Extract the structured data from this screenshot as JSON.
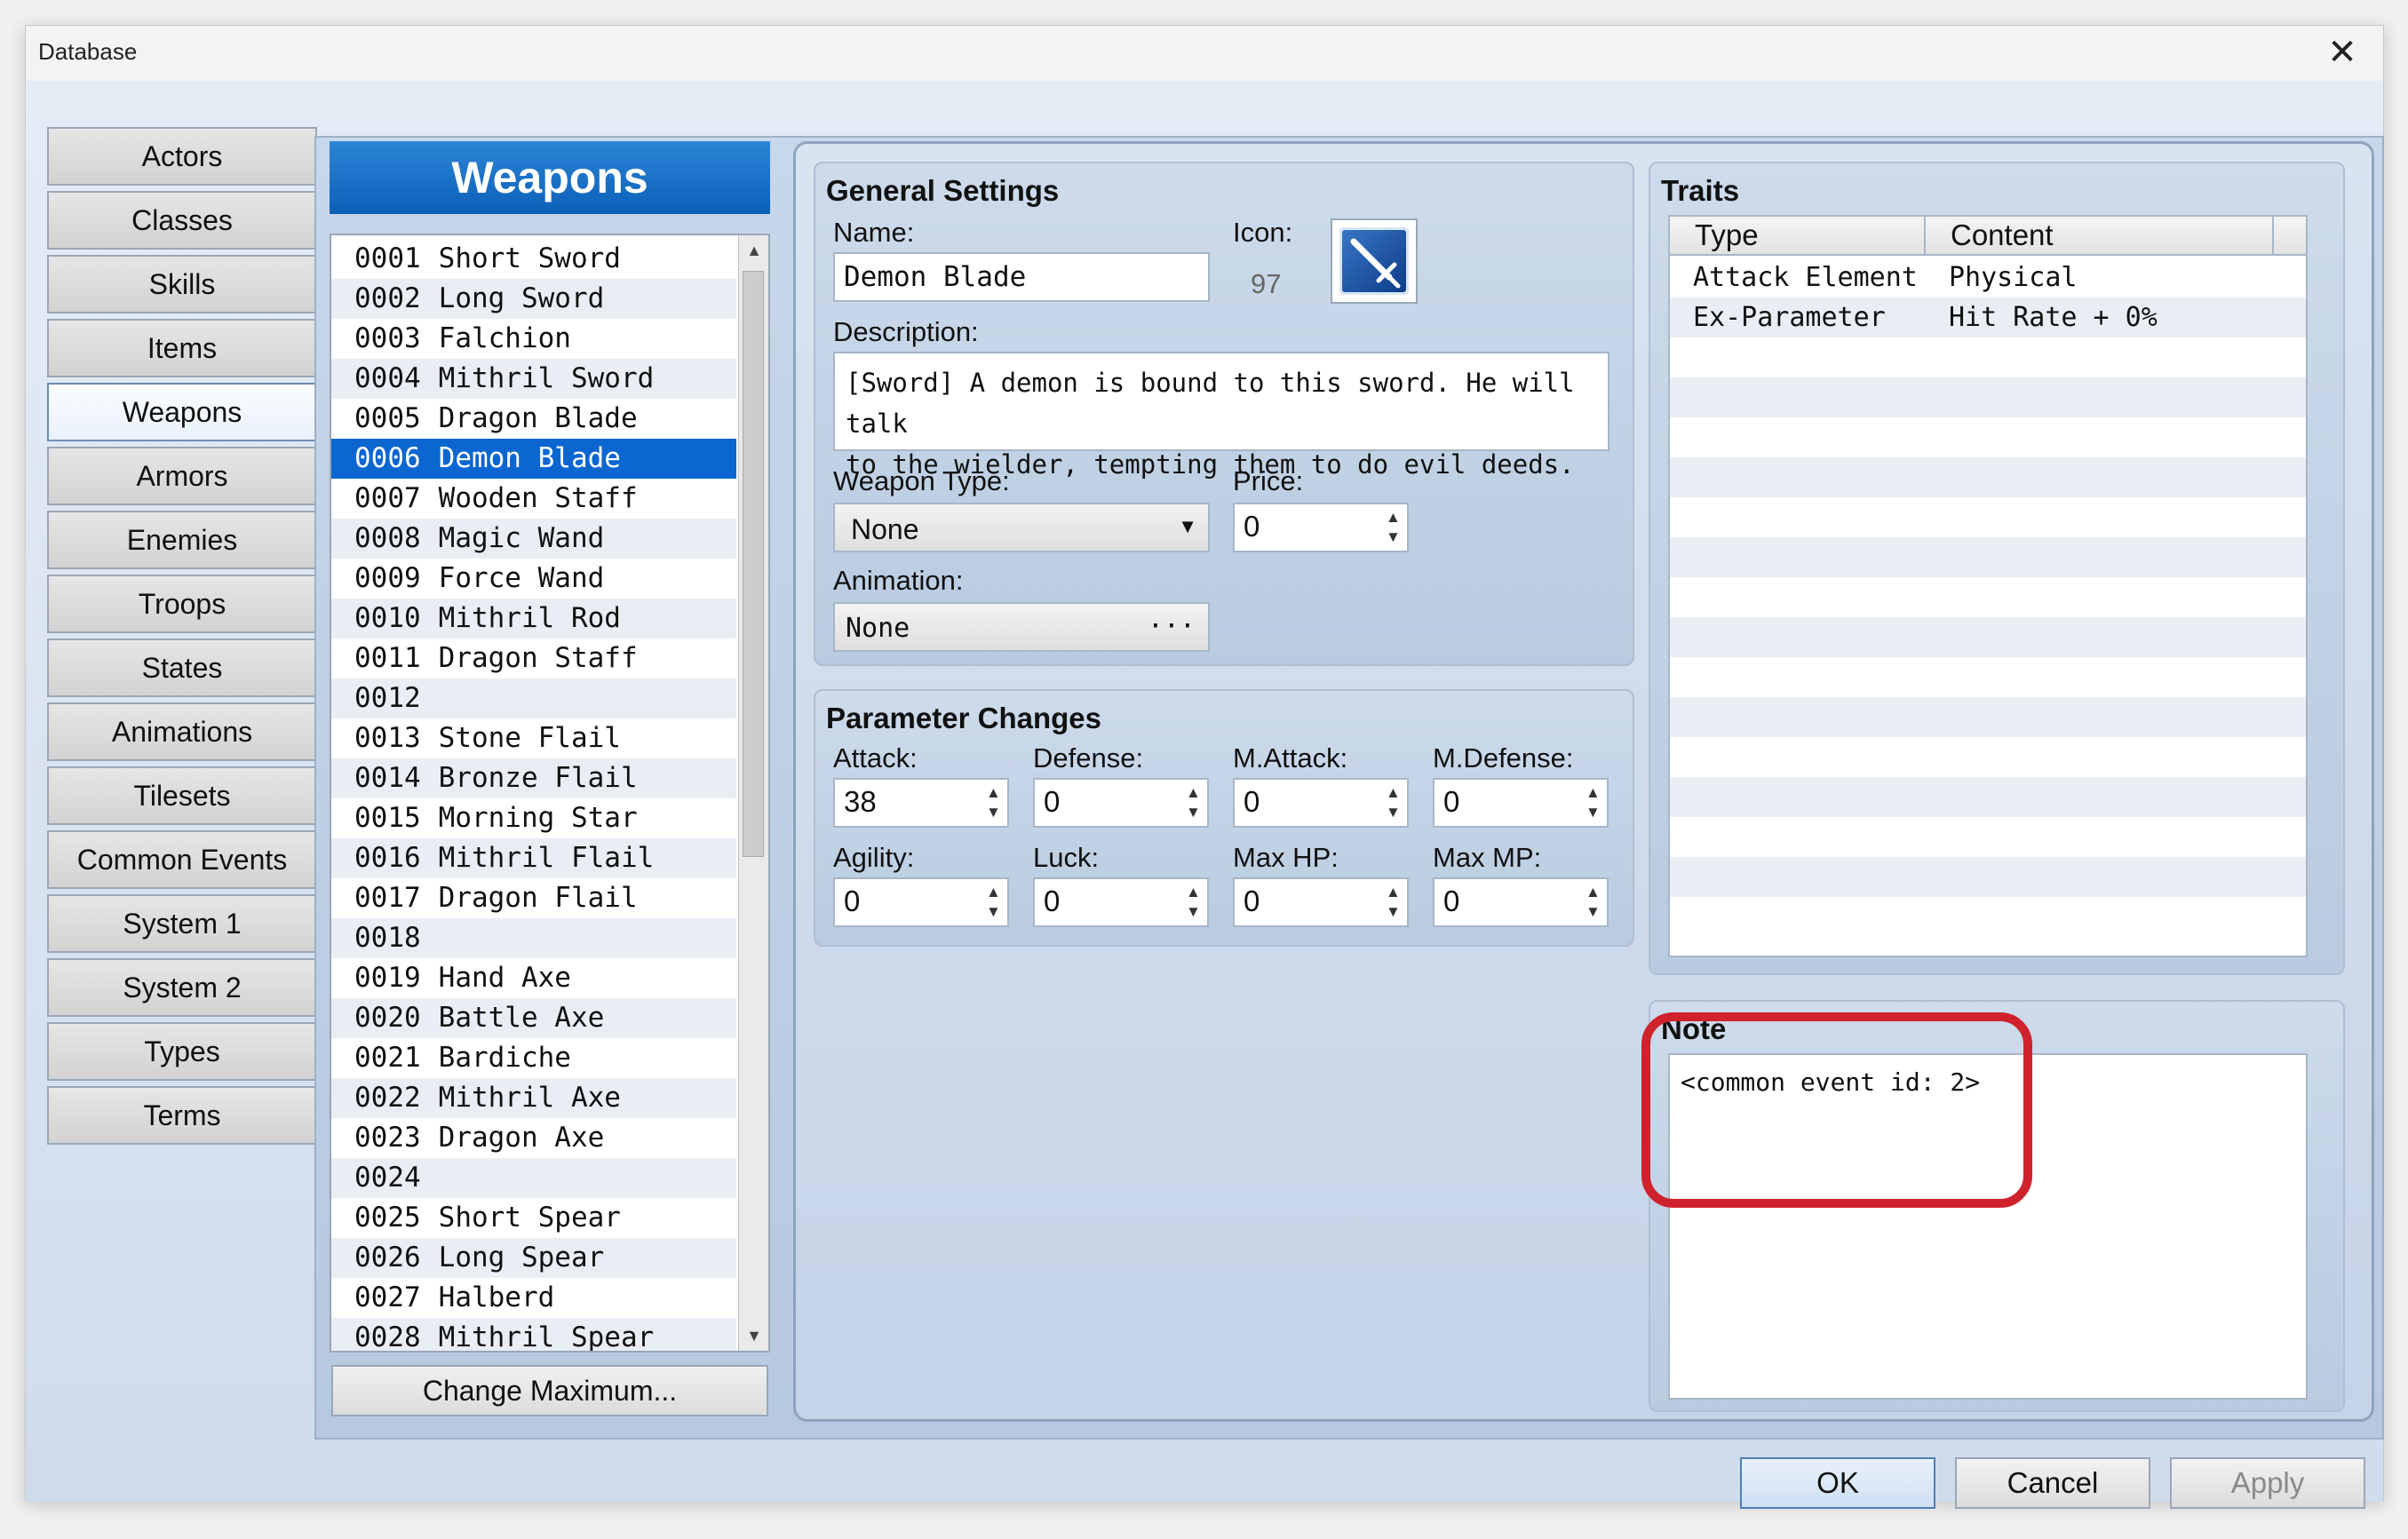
{
  "window": {
    "title": "Database",
    "close_glyph": "✕"
  },
  "categories": [
    {
      "label": "Actors"
    },
    {
      "label": "Classes"
    },
    {
      "label": "Skills"
    },
    {
      "label": "Items"
    },
    {
      "label": "Weapons",
      "selected": true
    },
    {
      "label": "Armors"
    },
    {
      "label": "Enemies"
    },
    {
      "label": "Troops"
    },
    {
      "label": "States"
    },
    {
      "label": "Animations"
    },
    {
      "label": "Tilesets"
    },
    {
      "label": "Common Events"
    },
    {
      "label": "System 1"
    },
    {
      "label": "System 2"
    },
    {
      "label": "Types"
    },
    {
      "label": "Terms"
    }
  ],
  "weapons_list": {
    "header": "Weapons",
    "selected_id": "0006",
    "items": [
      {
        "id": "0001",
        "name": "Short Sword"
      },
      {
        "id": "0002",
        "name": "Long Sword"
      },
      {
        "id": "0003",
        "name": "Falchion"
      },
      {
        "id": "0004",
        "name": "Mithril Sword"
      },
      {
        "id": "0005",
        "name": "Dragon Blade"
      },
      {
        "id": "0006",
        "name": "Demon Blade"
      },
      {
        "id": "0007",
        "name": "Wooden Staff"
      },
      {
        "id": "0008",
        "name": "Magic Wand"
      },
      {
        "id": "0009",
        "name": "Force Wand"
      },
      {
        "id": "0010",
        "name": "Mithril Rod"
      },
      {
        "id": "0011",
        "name": "Dragon Staff"
      },
      {
        "id": "0012",
        "name": ""
      },
      {
        "id": "0013",
        "name": "Stone Flail"
      },
      {
        "id": "0014",
        "name": "Bronze Flail"
      },
      {
        "id": "0015",
        "name": "Morning Star"
      },
      {
        "id": "0016",
        "name": "Mithril Flail"
      },
      {
        "id": "0017",
        "name": "Dragon Flail"
      },
      {
        "id": "0018",
        "name": ""
      },
      {
        "id": "0019",
        "name": "Hand Axe"
      },
      {
        "id": "0020",
        "name": "Battle Axe"
      },
      {
        "id": "0021",
        "name": "Bardiche"
      },
      {
        "id": "0022",
        "name": "Mithril Axe"
      },
      {
        "id": "0023",
        "name": "Dragon Axe"
      },
      {
        "id": "0024",
        "name": ""
      },
      {
        "id": "0025",
        "name": "Short Spear"
      },
      {
        "id": "0026",
        "name": "Long Spear"
      },
      {
        "id": "0027",
        "name": "Halberd"
      },
      {
        "id": "0028",
        "name": "Mithril Spear"
      }
    ],
    "change_max_label": "Change Maximum..."
  },
  "general": {
    "title": "General Settings",
    "name_label": "Name:",
    "name_value": "Demon Blade",
    "icon_label": "Icon:",
    "icon_index": "97",
    "icon_name": "sword-icon",
    "description_label": "Description:",
    "description_line1": "[Sword] A demon is bound to this sword. He will talk",
    "description_line2": "to the wielder, tempting them to do evil deeds.",
    "weapon_type_label": "Weapon Type:",
    "weapon_type_value": "None",
    "price_label": "Price:",
    "price_value": "0",
    "animation_label": "Animation:",
    "animation_value": "None",
    "ellipsis": "···"
  },
  "params": {
    "title": "Parameter Changes",
    "fields": [
      {
        "label": "Attack:",
        "value": "38"
      },
      {
        "label": "Defense:",
        "value": "0"
      },
      {
        "label": "M.Attack:",
        "value": "0"
      },
      {
        "label": "M.Defense:",
        "value": "0"
      },
      {
        "label": "Agility:",
        "value": "0"
      },
      {
        "label": "Luck:",
        "value": "0"
      },
      {
        "label": "Max HP:",
        "value": "0"
      },
      {
        "label": "Max MP:",
        "value": "0"
      }
    ]
  },
  "traits": {
    "title": "Traits",
    "col_type": "Type",
    "col_content": "Content",
    "rows": [
      {
        "type": "Attack Element",
        "content": "Physical"
      },
      {
        "type": "Ex-Parameter",
        "content": "Hit Rate + 0%"
      }
    ]
  },
  "note": {
    "title": "Note",
    "text": "<common event id: 2>",
    "highlight_color": "#d0222c"
  },
  "buttons": {
    "ok": "OK",
    "cancel": "Cancel",
    "apply": "Apply"
  },
  "colors": {
    "selection": "#0b66d0",
    "header": "#0c5fb8"
  }
}
